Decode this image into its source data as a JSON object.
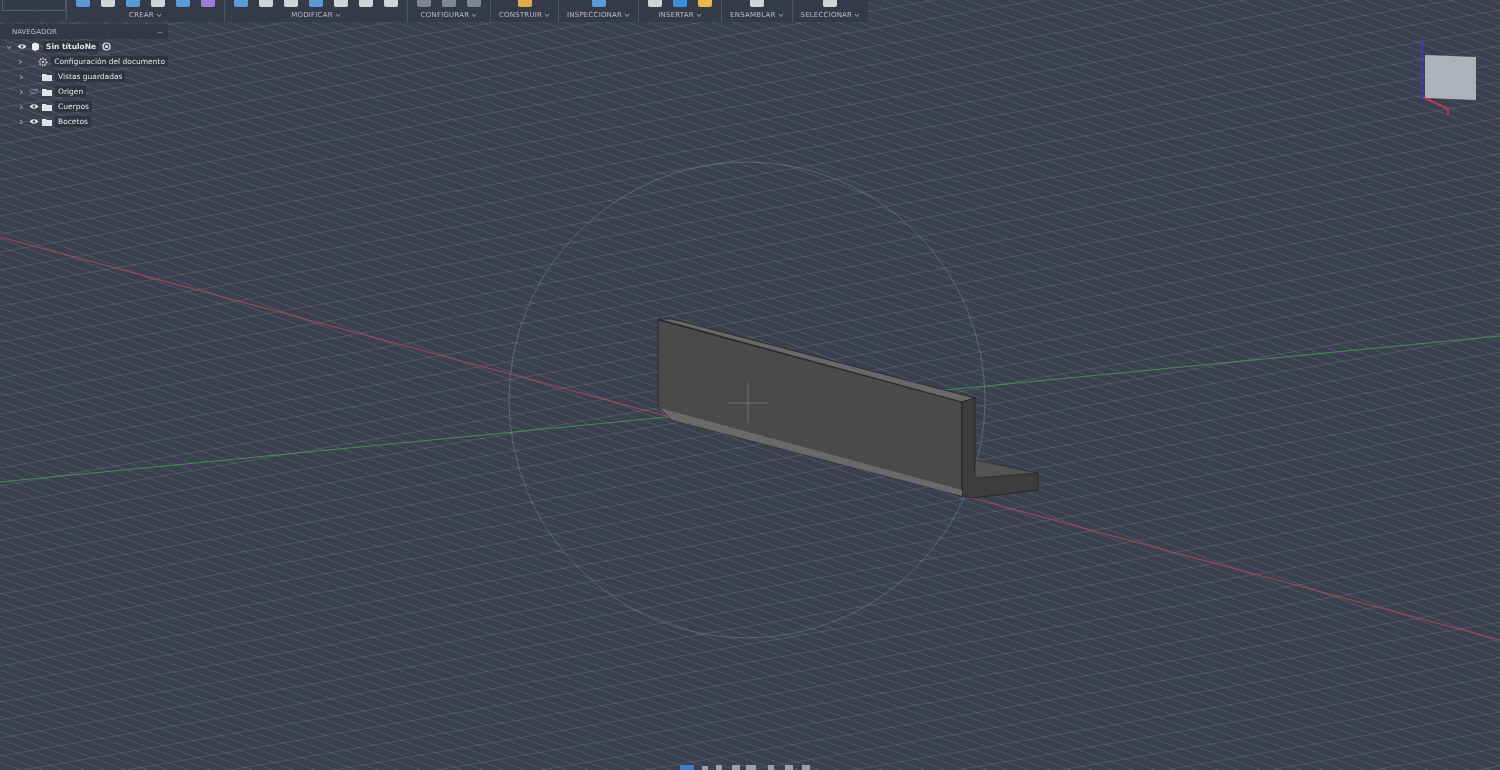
{
  "toolbar": {
    "groups": [
      {
        "label": "CREAR"
      },
      {
        "label": "MODIFICAR"
      },
      {
        "label": "CONFIGURAR"
      },
      {
        "label": "CONSTRUIR"
      },
      {
        "label": "INSPECCIONAR"
      },
      {
        "label": "INSERTAR"
      },
      {
        "label": "ENSAMBLAR"
      },
      {
        "label": "SELECCIONAR"
      }
    ]
  },
  "navigator": {
    "title": "NAVEGADOR",
    "collapse": "–",
    "root": {
      "label": "Sin títuloNe",
      "expanded": true,
      "children": [
        {
          "label": "Configuración del documento",
          "kind": "settings",
          "expanded": false
        },
        {
          "label": "Vistas guardadas",
          "kind": "folder",
          "expanded": false
        },
        {
          "label": "Origen",
          "kind": "folder",
          "expanded": false,
          "visible": false
        },
        {
          "label": "Cuerpos",
          "kind": "folder",
          "expanded": false,
          "visible": true
        },
        {
          "label": "Bocetos",
          "kind": "folder",
          "expanded": false,
          "visible": true
        }
      ]
    }
  }
}
